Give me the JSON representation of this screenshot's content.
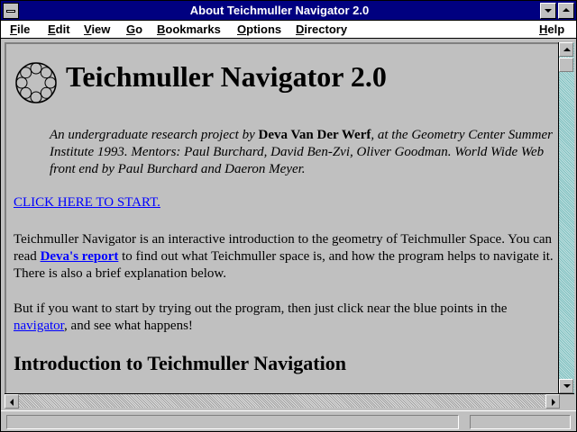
{
  "window": {
    "title": "About Teichmuller Navigator 2.0"
  },
  "menu": {
    "items": [
      {
        "label": "File",
        "accel": "F",
        "rest": "ile"
      },
      {
        "label": "Edit",
        "accel": "E",
        "rest": "dit"
      },
      {
        "label": "View",
        "accel": "V",
        "rest": "iew"
      },
      {
        "label": "Go",
        "accel": "G",
        "rest": "o"
      },
      {
        "label": "Bookmarks",
        "accel": "B",
        "rest": "ookmarks"
      },
      {
        "label": "Options",
        "accel": "O",
        "rest": "ptions"
      },
      {
        "label": "Directory",
        "accel": "D",
        "rest": "irectory"
      },
      {
        "label": "Help",
        "accel": "H",
        "rest": "elp"
      }
    ]
  },
  "page": {
    "title": "Teichmuller Navigator 2.0",
    "intro": {
      "prefix": "An undergraduate research project by ",
      "author": "Deva Van Der Werf",
      "suffix": ", at the Geometry Center Summer Institute 1993. Mentors: Paul Burchard, David Ben-Zvi, Oliver Goodman. World Wide Web front end by Paul Burchard and Daeron Meyer."
    },
    "start_link": "CLICK HERE TO START.",
    "para1": {
      "text1": "Teichmuller Navigator is an interactive introduction to the geometry of Teichmuller Space. You can read ",
      "link": "Deva's report",
      "text2": " to find out what Teichmuller space is, and how the program helps to navigate it. There is also a brief explanation below."
    },
    "para2": {
      "text1": "But if you want to start by trying out the program, then just click near the blue points in the ",
      "link": "navigator",
      "text2": ", and see what happens!"
    },
    "section_heading": "Introduction to Teichmuller Navigation"
  },
  "status": {
    "text": ""
  },
  "icons": {
    "logo": "circle-packing-logo-icon",
    "system_menu": "system-menu-icon",
    "minimize": "minimize-icon",
    "maximize": "maximize-icon"
  },
  "colors": {
    "title_bar": "#000080",
    "link": "#0000ff",
    "background": "#c0c0c0",
    "scroll_track": "#00c0c0"
  }
}
